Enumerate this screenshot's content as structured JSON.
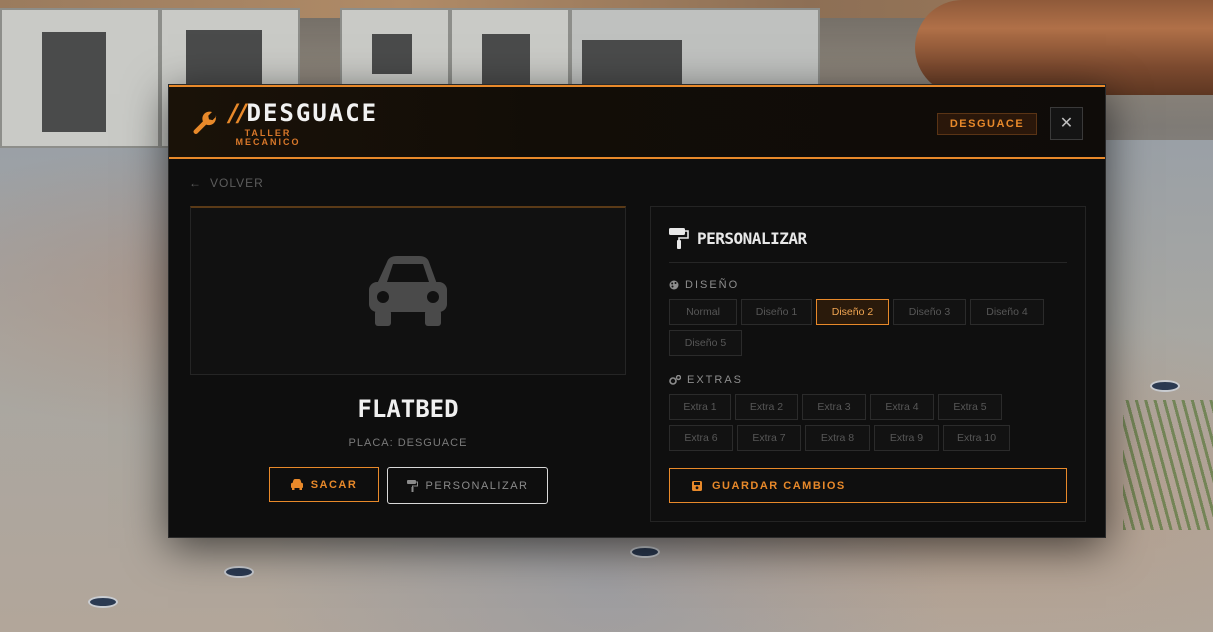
{
  "header": {
    "title_prefix": "//",
    "title": "DESGUACE",
    "subtitle_line1": "TALLER",
    "subtitle_line2": "MECANICO",
    "badge": "DESGUACE",
    "close_glyph": "✕",
    "logo_icon": "wrench-icon",
    "accent_color": "#e8892a"
  },
  "nav": {
    "back_label": "VOLVER",
    "back_icon": "arrow-left-icon"
  },
  "vehicle": {
    "name": "FLATBED",
    "plate_label": "PLACA:",
    "plate_value": "DESGUACE",
    "preview_icon": "car-icon",
    "actions": {
      "sacar_label": "SACAR",
      "personalizar_label": "PERSONALIZAR"
    }
  },
  "customize": {
    "title": "PERSONALIZAR",
    "title_icon": "paint-roller-icon",
    "design": {
      "label": "DISEÑO",
      "icon": "palette-icon",
      "options": [
        "Normal",
        "Diseño 1",
        "Diseño 2",
        "Diseño 3",
        "Diseño 4",
        "Diseño 5"
      ],
      "selected": "Diseño 2"
    },
    "extras": {
      "label": "EXTRAS",
      "icon": "cogs-icon",
      "options": [
        "Extra 1",
        "Extra 2",
        "Extra 3",
        "Extra 4",
        "Extra 5",
        "Extra 6",
        "Extra 7",
        "Extra 8",
        "Extra 9",
        "Extra 10"
      ]
    },
    "save_label": "GUARDAR CAMBIOS",
    "save_icon": "save-icon"
  }
}
